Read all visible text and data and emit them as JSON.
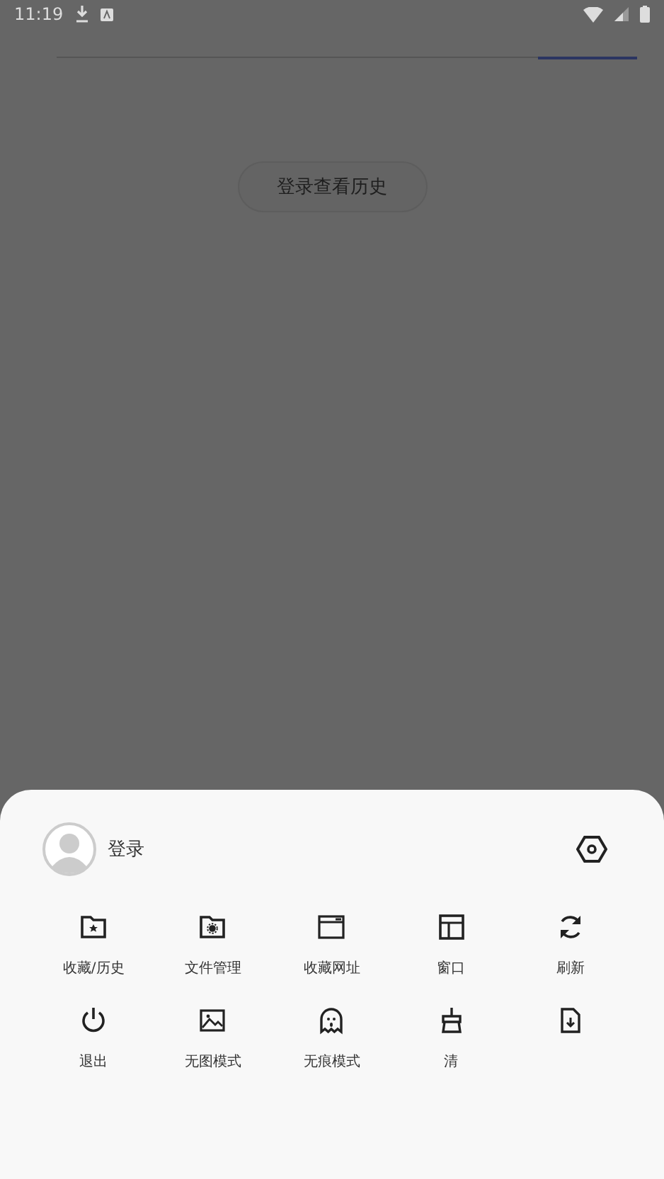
{
  "status_bar": {
    "time": "11:19"
  },
  "history_button": {
    "label": "登录查看历史"
  },
  "tab_indicator": {
    "level": 0.17
  },
  "menu": {
    "account": {
      "label": "登录"
    },
    "items": [
      {
        "kind": "favorites",
        "label": "收藏/历史"
      },
      {
        "kind": "files",
        "label": "文件管理"
      },
      {
        "kind": "bookmarks",
        "label": "收藏网址"
      },
      {
        "kind": "windows",
        "label": "窗口"
      },
      {
        "kind": "refresh",
        "label": "刷新"
      },
      {
        "kind": "exit",
        "label": "退出"
      },
      {
        "kind": "noimage",
        "label": "无图模式"
      },
      {
        "kind": "incognito",
        "label": "无痕模式"
      },
      {
        "kind": "clean",
        "label": "清"
      },
      {
        "kind": "download"
      }
    ]
  }
}
